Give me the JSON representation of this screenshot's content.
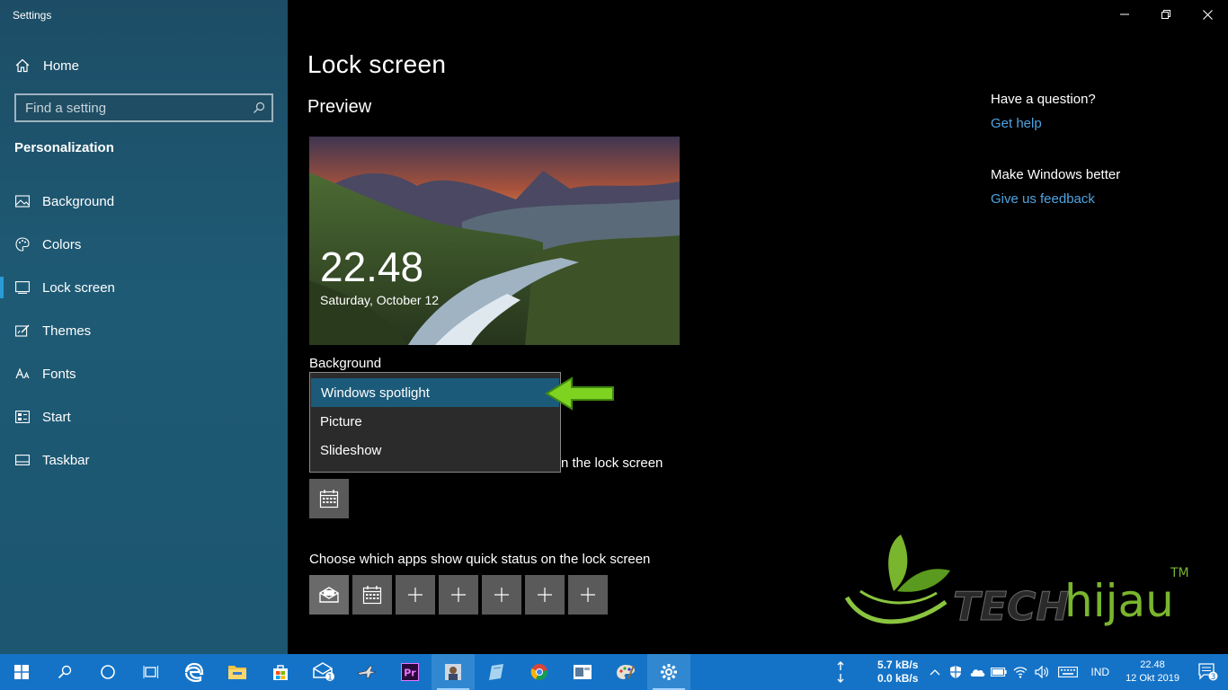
{
  "window": {
    "title": "Settings"
  },
  "sidebar": {
    "home_label": "Home",
    "search_placeholder": "Find a setting",
    "section_title": "Personalization",
    "items": [
      {
        "label": "Background",
        "icon": "picture-icon"
      },
      {
        "label": "Colors",
        "icon": "palette-icon"
      },
      {
        "label": "Lock screen",
        "icon": "lock-screen-icon",
        "active": true
      },
      {
        "label": "Themes",
        "icon": "themes-icon"
      },
      {
        "label": "Fonts",
        "icon": "fonts-icon"
      },
      {
        "label": "Start",
        "icon": "start-icon"
      },
      {
        "label": "Taskbar",
        "icon": "taskbar-icon"
      }
    ]
  },
  "main": {
    "title": "Lock screen",
    "preview_title": "Preview",
    "preview_time": "22.48",
    "preview_date": "Saturday, October 12",
    "background_label": "Background",
    "dropdown_options": [
      "Windows spotlight",
      "Picture",
      "Slideshow"
    ],
    "selected_option": "Windows spotlight",
    "detail_status_text": "n the lock screen",
    "quick_status_label": "Choose which apps show quick status on the lock screen"
  },
  "help": {
    "question": "Have a question?",
    "get_help": "Get help",
    "feedback_title": "Make Windows better",
    "feedback_link": "Give us feedback"
  },
  "watermark": {
    "text_tech": "TECH",
    "text_hijau": "hijau",
    "tm": "TM"
  },
  "taskbar": {
    "net_up": "5.7 kB/s",
    "net_down": "0.0 kB/s",
    "language": "IND",
    "time": "22.48",
    "date": "12 Okt 2019",
    "mail_badge": "1",
    "notification_count": "3"
  },
  "colors": {
    "accent": "#1473c7",
    "link": "#4fa3e0",
    "selected": "#1c5a7a",
    "arrow": "#7ed321"
  }
}
